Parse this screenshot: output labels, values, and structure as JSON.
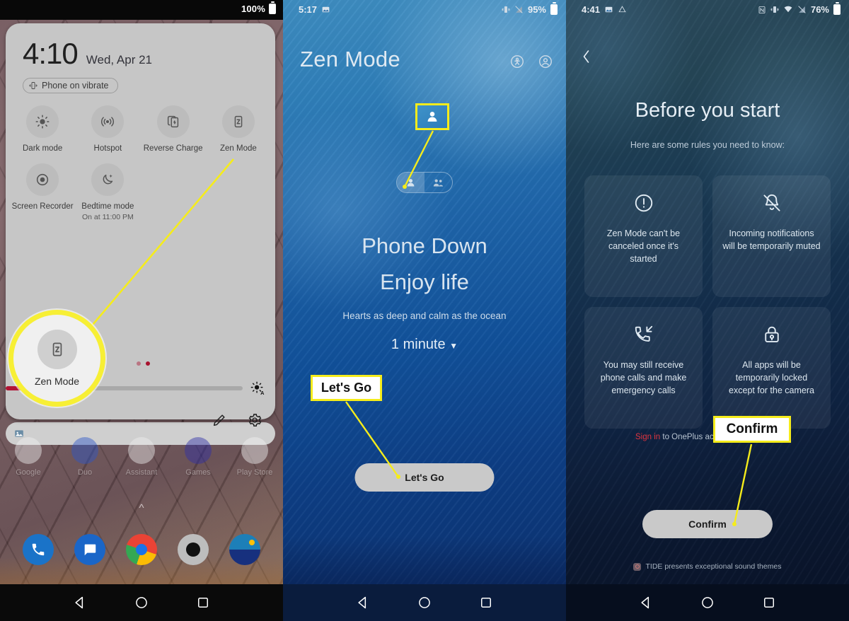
{
  "panel1": {
    "status_bar": {
      "battery_percent": "100%",
      "battery_icon": "battery-full-icon"
    },
    "shade": {
      "time": "4:10",
      "date": "Wed, Apr 21",
      "vibrate_chip": "Phone on vibrate",
      "vibrate_icon": "vibrate-icon",
      "tiles": [
        {
          "label": "Dark mode",
          "icon": "brightness-dark-mode-icon",
          "sub": ""
        },
        {
          "label": "Hotspot",
          "icon": "hotspot-icon",
          "sub": ""
        },
        {
          "label": "Reverse Charge",
          "icon": "reverse-charge-icon",
          "sub": ""
        },
        {
          "label": "Zen Mode",
          "icon": "zen-mode-z-icon",
          "sub": ""
        },
        {
          "label": "Screen Recorder",
          "icon": "screen-recorder-icon",
          "sub": ""
        },
        {
          "label": "Bedtime mode",
          "icon": "bedtime-moon-icon",
          "sub": "On at 11:00 PM"
        }
      ],
      "brightness": {
        "value_percent": 22,
        "auto_icon": "brightness-auto-icon"
      },
      "page_dots": 2,
      "edit_icon": "pencil-edit-icon",
      "settings_icon": "gear-settings-icon"
    },
    "home": {
      "search_icon": "image-search-icon",
      "apps": [
        {
          "label": "Google",
          "icon": "google-folder-icon"
        },
        {
          "label": "Duo",
          "icon": "duo-icon"
        },
        {
          "label": "Assistant",
          "icon": "assistant-icon"
        },
        {
          "label": "Games",
          "icon": "games-icon"
        },
        {
          "label": "Play Store",
          "icon": "play-store-icon"
        }
      ],
      "dock": [
        {
          "label": "Phone",
          "icon": "phone-icon"
        },
        {
          "label": "Messages",
          "icon": "messages-icon"
        },
        {
          "label": "Chrome",
          "icon": "chrome-icon"
        },
        {
          "label": "Camera",
          "icon": "camera-icon"
        },
        {
          "label": "Gallery",
          "icon": "gallery-icon"
        }
      ],
      "drawer_arrow_icon": "chevron-up-icon"
    },
    "nav": {
      "back": "back-triangle-icon",
      "home": "home-circle-icon",
      "recents": "recents-square-icon"
    },
    "annotation": {
      "magnifier_label": "Zen Mode",
      "magnifier_icon": "zen-mode-z-icon"
    }
  },
  "panel2": {
    "status_bar": {
      "time": "5:17",
      "battery_percent": "95%",
      "left_icons": [
        "screenshot-image-icon"
      ],
      "right_icons": [
        "vibrate-icon",
        "no-signal-icon",
        "battery-icon"
      ]
    },
    "header": {
      "title": "Zen Mode",
      "action_icons": [
        "zen-stats-icon",
        "account-profile-icon"
      ]
    },
    "mode_toggle": {
      "selected": "solo",
      "options": [
        {
          "key": "solo",
          "icon": "single-person-icon"
        },
        {
          "key": "group",
          "icon": "group-people-icon"
        }
      ]
    },
    "hero": {
      "line1": "Phone Down",
      "line2": "Enjoy life",
      "subtitle": "Hearts as deep and calm as the ocean",
      "duration": "1 minute",
      "duration_caret_icon": "chevron-down-icon"
    },
    "primary_button": "Let's Go",
    "nav": {
      "back": "back-triangle-icon",
      "home": "home-circle-icon",
      "recents": "recents-square-icon"
    },
    "annotation": {
      "callout_label": "Let's Go",
      "crop_icon": "single-person-icon"
    }
  },
  "panel3": {
    "status_bar": {
      "time": "4:41",
      "battery_percent": "76%",
      "left_icons": [
        "screenshot-image-icon",
        "drive-icon"
      ],
      "right_icons": [
        "nfc-icon",
        "vibrate-icon",
        "wifi-icon",
        "no-signal-icon",
        "battery-icon"
      ]
    },
    "back_icon": "chevron-left-icon",
    "title": "Before you start",
    "subtitle": "Here are some rules you need to know:",
    "rules": [
      {
        "icon": "exclamation-circle-icon",
        "text": "Zen Mode can't be canceled once it's started"
      },
      {
        "icon": "bell-off-icon",
        "text": "Incoming notifications will be temporarily muted"
      },
      {
        "icon": "phone-incoming-icon",
        "text": "You may still receive phone calls and make emergency calls"
      },
      {
        "icon": "lock-icon",
        "text": "All apps will be temporarily locked except for the camera"
      }
    ],
    "signin": {
      "link": "Sign in",
      "rest": " to OnePlus account to sync data"
    },
    "primary_button": "Confirm",
    "footer": {
      "icon": "tide-icon",
      "text": "TIDE presents exceptional sound themes"
    },
    "nav": {
      "back": "back-triangle-icon",
      "home": "home-circle-icon",
      "recents": "recents-square-icon"
    },
    "annotation": {
      "callout_label": "Confirm"
    }
  },
  "colors": {
    "highlight_yellow": "#f5ec1b",
    "slider_red": "#b11334",
    "signin_red": "#e0343f",
    "button_grey": "#c9c9c9"
  }
}
